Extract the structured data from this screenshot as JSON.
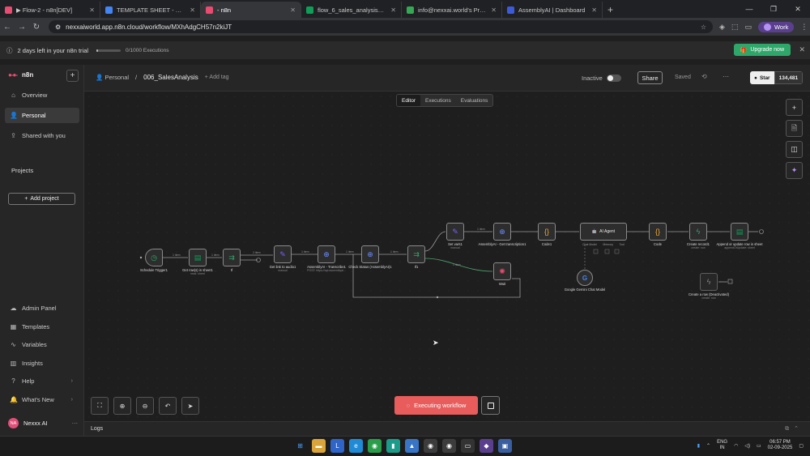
{
  "browser": {
    "tabs": [
      {
        "title": "▶ Flow-2 - n8n[DEV]",
        "color": "#ea4b71",
        "active": false
      },
      {
        "title": "TEMPLATE SHEET - Google Docs",
        "color": "#4285f4",
        "active": false
      },
      {
        "title": "- n8n",
        "color": "#ea4b71",
        "active": true
      },
      {
        "title": "flow_6_sales_analysis_sheet - G",
        "color": "#0f9d58",
        "active": false
      },
      {
        "title": "info@nexxai.world's Project | in",
        "color": "#34a853",
        "active": false
      },
      {
        "title": "AssemblyAI | Dashboard",
        "color": "#3b5bdb",
        "active": false
      }
    ],
    "url": "nexxaiworld.app.n8n.cloud/workflow/MXhAdgCH57n2kiJT",
    "profile_label": "Work"
  },
  "trial": {
    "text": "2 days left in your n8n trial",
    "executions": "0/1000 Executions",
    "usage_fraction": 0.0,
    "upgrade_label": "Upgrade now"
  },
  "sidebar": {
    "brand": "n8n",
    "items": [
      {
        "label": "Overview",
        "icon": "home-icon"
      },
      {
        "label": "Personal",
        "icon": "user-icon"
      },
      {
        "label": "Shared with you",
        "icon": "share-icon"
      }
    ],
    "projects_label": "Projects",
    "add_project_label": "Add project",
    "bottom_items": [
      {
        "label": "Admin Panel",
        "icon": "cloud-icon"
      },
      {
        "label": "Templates",
        "icon": "templates-icon"
      },
      {
        "label": "Variables",
        "icon": "variables-icon"
      },
      {
        "label": "Insights",
        "icon": "insights-icon"
      },
      {
        "label": "Help",
        "icon": "help-icon"
      },
      {
        "label": "What's New",
        "icon": "bell-icon"
      }
    ],
    "user": {
      "initials": "NA",
      "name": "Nexxx AI"
    }
  },
  "header": {
    "owner": "Personal",
    "workflow_name": "006_SalesAnalysis",
    "add_tag": "+ Add tag",
    "status_label": "Inactive",
    "share_label": "Share",
    "saved_label": "Saved",
    "github_star": "Star",
    "github_count": "134,481"
  },
  "canvas": {
    "mode_tabs": [
      "Editor",
      "Executions",
      "Evaluations"
    ],
    "active_mode": "Editor",
    "execute_label": "Executing workflow",
    "nodes": [
      {
        "id": "n1",
        "label": "Schedule Trigger1",
        "sub": "",
        "icon": "clock-icon",
        "color": "#2ea86a"
      },
      {
        "id": "n2",
        "label": "Get row(s) in sheet1",
        "sub": "read: sheet",
        "icon": "sheets-icon",
        "color": "#0f9d58"
      },
      {
        "id": "n3",
        "label": "If",
        "sub": "",
        "icon": "if-icon",
        "color": "#2ea86a"
      },
      {
        "id": "n4",
        "label": "Get link to audio1",
        "sub": "manual",
        "icon": "pen-icon",
        "color": "#7b61ff"
      },
      {
        "id": "n5",
        "label": "AssemblyAI - Transcribe1",
        "sub": "POST: https://api.assemblyai...",
        "icon": "globe-icon",
        "color": "#6b8cff"
      },
      {
        "id": "n6",
        "label": "Check Status (AssemblyAI)1",
        "sub": "",
        "icon": "globe-icon",
        "color": "#6b8cff"
      },
      {
        "id": "n7",
        "label": "If1",
        "sub": "",
        "icon": "if-icon",
        "color": "#2ea86a"
      },
      {
        "id": "n8",
        "label": "Set vars1",
        "sub": "manual",
        "icon": "pen-icon",
        "color": "#7b61ff"
      },
      {
        "id": "n9",
        "label": "AssemblyAI - Get transcription1",
        "sub": "",
        "icon": "globe-icon",
        "color": "#6b8cff"
      },
      {
        "id": "n10",
        "label": "Code1",
        "sub": "",
        "icon": "code-icon",
        "color": "#f0a830"
      },
      {
        "id": "n11",
        "label": "AI Agent",
        "sub": "",
        "icon": "robot-icon",
        "color": "#eeeeee"
      },
      {
        "id": "n12",
        "label": "Code",
        "sub": "",
        "icon": "code-icon",
        "color": "#f0a830"
      },
      {
        "id": "n13",
        "label": "Create record1",
        "sub": "create: row",
        "icon": "bolt-icon",
        "color": "#2ea86a"
      },
      {
        "id": "n14",
        "label": "Append or update row in sheet",
        "sub": "appendOrUpdate: sheet",
        "icon": "sheets-icon",
        "color": "#0f9d58"
      },
      {
        "id": "n15",
        "label": "Wait",
        "sub": "",
        "icon": "wait-icon",
        "color": "#ea4b71"
      },
      {
        "id": "n16",
        "label": "Google Gemini Chat Model",
        "sub": "",
        "icon": "gemini-icon",
        "color": "#4285f4"
      },
      {
        "id": "n17",
        "label": "Create a row (Deactivated)",
        "sub": "create: row",
        "icon": "bolt-icon",
        "color": "#cccccc"
      }
    ],
    "edge_labels": [
      "1 item",
      "1 item",
      "1 item",
      "1 item",
      "1 item",
      "1 item",
      "1 item",
      "1 item"
    ],
    "agent_sub_labels": [
      "Chat Model",
      "Memory",
      "Tool"
    ]
  },
  "logs": {
    "label": "Logs"
  },
  "taskbar": {
    "lang": "ENG",
    "region": "IN",
    "time": "06:57 PM",
    "date": "02-09-2025"
  }
}
